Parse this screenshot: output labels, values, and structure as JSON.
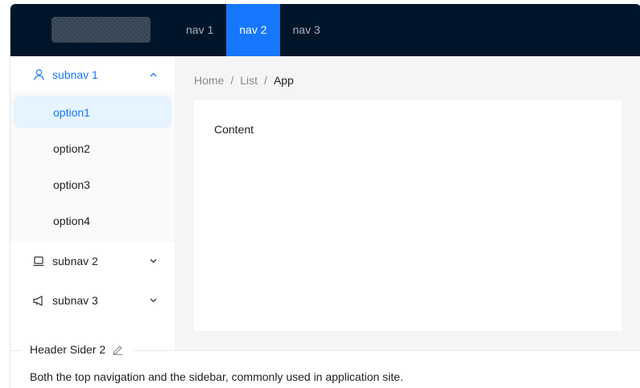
{
  "header": {
    "logo": "logo-placeholder",
    "nav": [
      {
        "label": "nav 1",
        "selected": false
      },
      {
        "label": "nav 2",
        "selected": true
      },
      {
        "label": "nav 3",
        "selected": false
      }
    ]
  },
  "sider": {
    "submenus": [
      {
        "label": "subnav 1",
        "icon": "user-icon",
        "open": true,
        "options": [
          "option1",
          "option2",
          "option3",
          "option4"
        ],
        "selected_option": "option1"
      },
      {
        "label": "subnav 2",
        "icon": "laptop-icon",
        "open": false
      },
      {
        "label": "subnav 3",
        "icon": "notification-icon",
        "open": false
      }
    ]
  },
  "breadcrumb": {
    "items": [
      "Home",
      "List",
      "App"
    ],
    "separator": "/"
  },
  "content": {
    "text": "Content"
  },
  "demo": {
    "title": "Header Sider 2",
    "description": "Both the top navigation and the sidebar, commonly used in application site."
  },
  "colors": {
    "header_bg": "#001529",
    "primary": "#1677ff",
    "selected_bg": "#e6f4ff",
    "layout_bg": "#f5f5f5"
  }
}
